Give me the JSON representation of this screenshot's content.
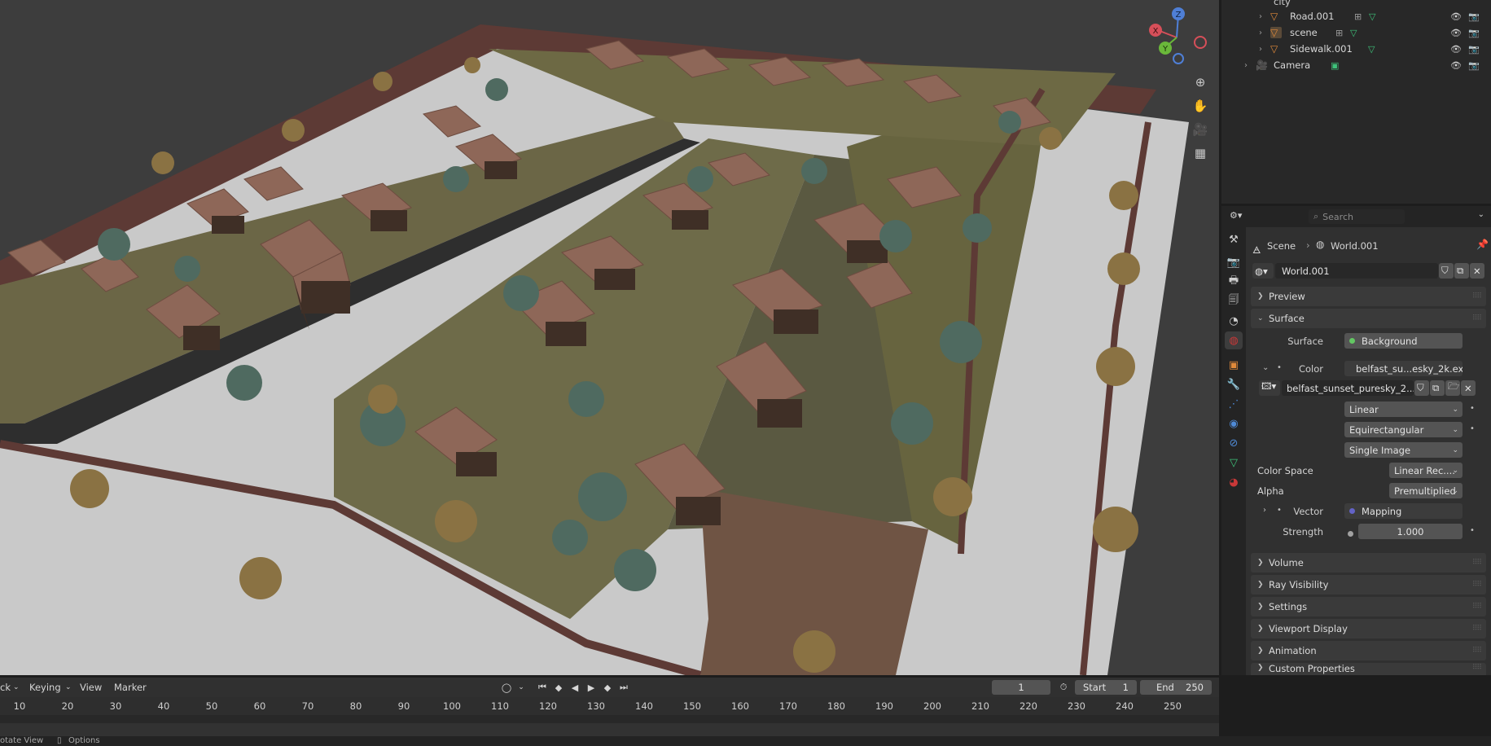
{
  "outliner": {
    "partial_top": "city",
    "rows": [
      {
        "label": "Road.001"
      },
      {
        "label": "scene"
      },
      {
        "label": "Sidewalk.001"
      },
      {
        "label": "Camera"
      }
    ]
  },
  "viewport": {
    "gizmo_axes": {
      "z": "Z",
      "x": "X",
      "y": "Y"
    },
    "icons": [
      "zoom-icon",
      "hand-pan-icon",
      "camera-view-icon",
      "grid-ortho-icon"
    ]
  },
  "properties": {
    "search_placeholder": "Search",
    "breadcrumb": {
      "scene": "Scene",
      "world": "World.001"
    },
    "world_name": "World.001",
    "panels": {
      "preview": "Preview",
      "surface": "Surface",
      "volume": "Volume",
      "ray_visibility": "Ray Visibility",
      "settings": "Settings",
      "viewport_display": "Viewport Display",
      "animation": "Animation",
      "custom_properties": "Custom Properties"
    },
    "surface": {
      "surface_label": "Surface",
      "surface_value": "Background",
      "color_label": "Color",
      "color_value": "belfast_su...esky_2k.exr",
      "image_name": "belfast_sunset_puresky_2...",
      "interpolation": "Linear",
      "projection": "Equirectangular",
      "source": "Single Image",
      "color_space_label": "Color Space",
      "color_space_value": "Linear Rec....",
      "alpha_label": "Alpha",
      "alpha_value": "Premultiplied",
      "vector_label": "Vector",
      "vector_value": "Mapping",
      "strength_label": "Strength",
      "strength_value": "1.000"
    },
    "colors": {
      "surface_socket": "#63c763",
      "color_socket": "#c7c729",
      "vector_socket": "#6363c7",
      "strength_socket": "#a1a1a1",
      "active_tab": "#c93838"
    }
  },
  "timeline": {
    "menus": {
      "playback": "ck",
      "keying": "Keying",
      "view": "View",
      "marker": "Marker"
    },
    "current_frame": "1",
    "start_label": "Start",
    "start_value": "1",
    "end_label": "End",
    "end_value": "250",
    "ticks": [
      "10",
      "20",
      "30",
      "40",
      "50",
      "60",
      "70",
      "80",
      "90",
      "100",
      "110",
      "120",
      "130",
      "140",
      "150",
      "160",
      "170",
      "180",
      "190",
      "200",
      "210",
      "220",
      "230",
      "240",
      "250"
    ]
  },
  "status": {
    "left": "otate View",
    "options": "Options"
  }
}
